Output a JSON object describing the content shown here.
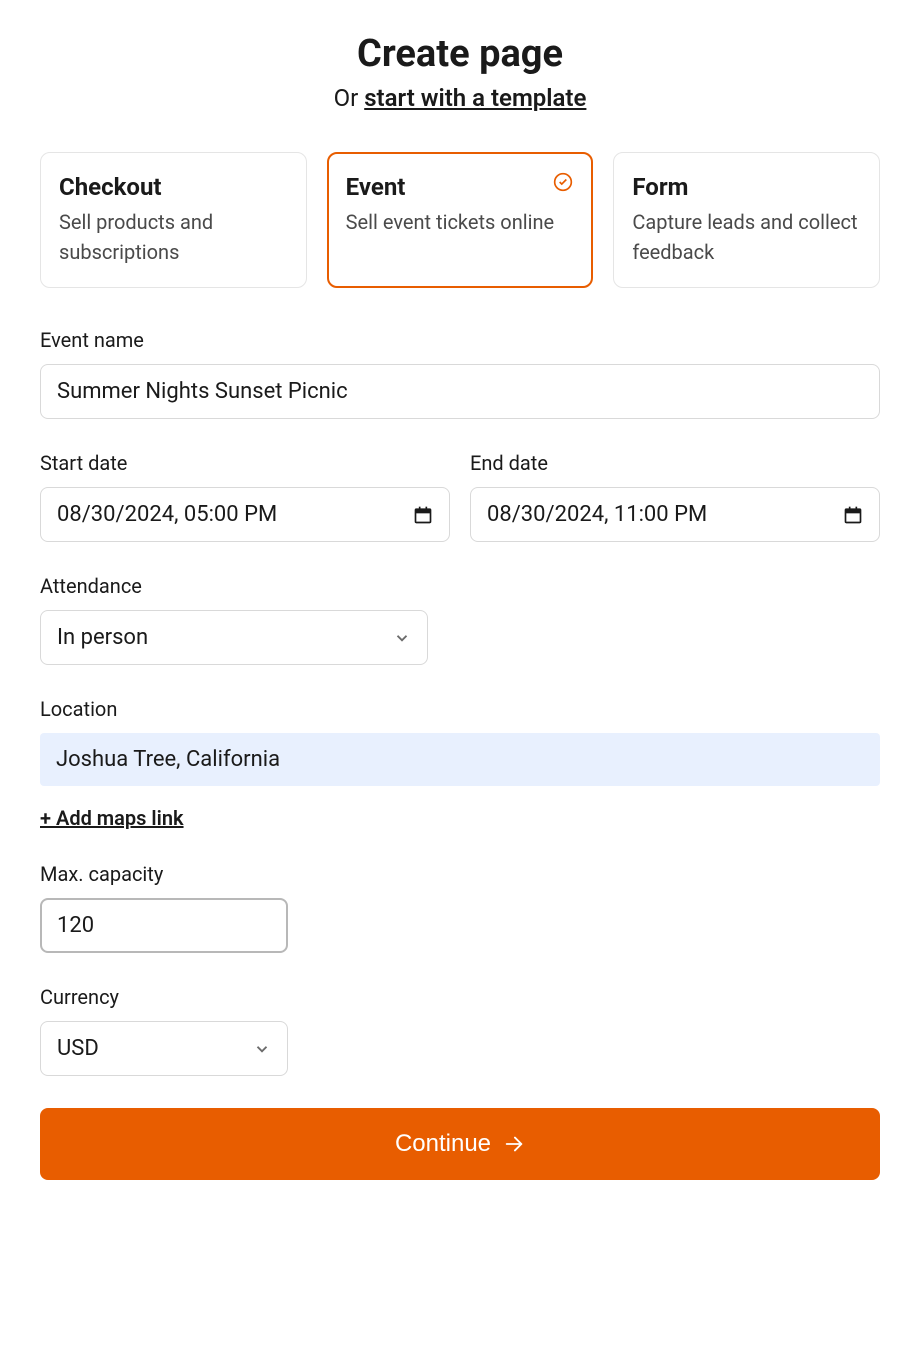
{
  "header": {
    "title": "Create page",
    "subtitle_prefix": "Or ",
    "subtitle_link": "start with a template"
  },
  "type_cards": [
    {
      "title": "Checkout",
      "desc": "Sell products and subscriptions",
      "selected": false
    },
    {
      "title": "Event",
      "desc": "Sell event tickets online",
      "selected": true
    },
    {
      "title": "Form",
      "desc": "Capture leads and collect feedback",
      "selected": false
    }
  ],
  "form": {
    "event_name": {
      "label": "Event name",
      "value": "Summer Nights Sunset Picnic"
    },
    "start_date": {
      "label": "Start date",
      "value": "08/30/2024, 05:00 PM"
    },
    "end_date": {
      "label": "End date",
      "value": "08/30/2024, 11:00 PM"
    },
    "attendance": {
      "label": "Attendance",
      "value": "In person"
    },
    "location": {
      "label": "Location",
      "value": "Joshua Tree, California"
    },
    "add_maps_link": "+ Add maps link",
    "max_capacity": {
      "label": "Max. capacity",
      "value": "120"
    },
    "currency": {
      "label": "Currency",
      "value": "USD"
    }
  },
  "continue_button": "Continue",
  "colors": {
    "accent": "#e85d00"
  }
}
